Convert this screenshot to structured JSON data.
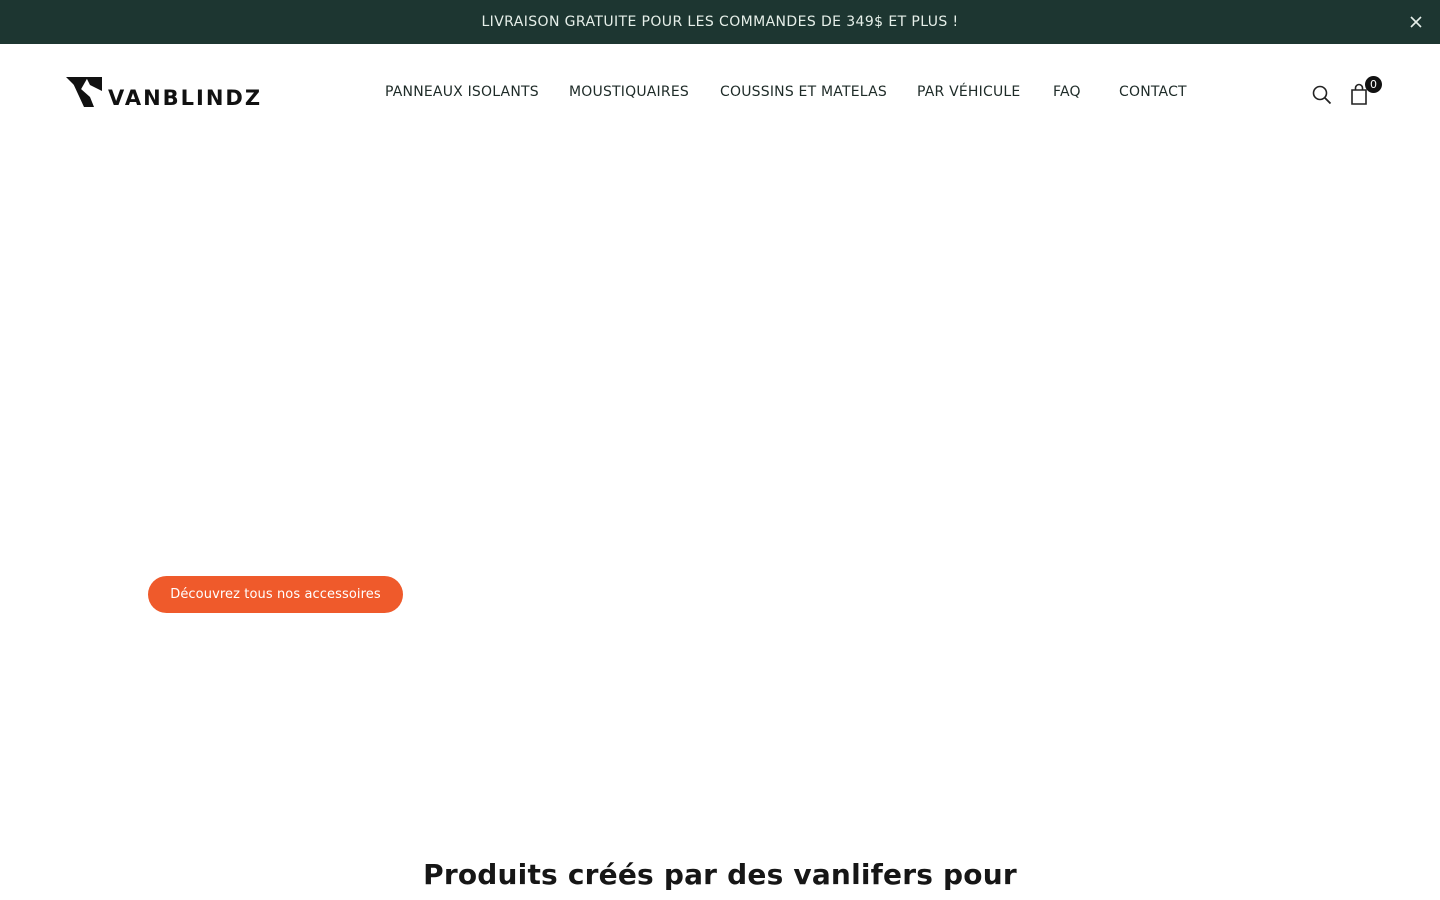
{
  "announcement": {
    "text": "LIVRAISON GRATUITE POUR LES COMMANDES DE 349$ ET PLUS !",
    "close_icon": "close-icon"
  },
  "brand": {
    "name": "VANBLINDZ"
  },
  "nav": {
    "items": [
      {
        "label": "PANNEAUX ISOLANTS"
      },
      {
        "label": "MOUSTIQUAIRES"
      },
      {
        "label": "COUSSINS ET MATELAS"
      },
      {
        "label": "PAR VÉHICULE"
      },
      {
        "label": "FAQ"
      },
      {
        "label": "CONTACT"
      }
    ]
  },
  "header_icons": {
    "search_icon": "search-icon",
    "cart_icon": "shopping-bag-icon",
    "cart_count": "0"
  },
  "hero": {
    "cta_label": "Découvrez tous nos accessoires"
  },
  "section": {
    "title": "Produits créés par des vanlifers pour"
  },
  "colors": {
    "announcement_bg": "#1d3631",
    "accent": "#ef5a2b"
  }
}
